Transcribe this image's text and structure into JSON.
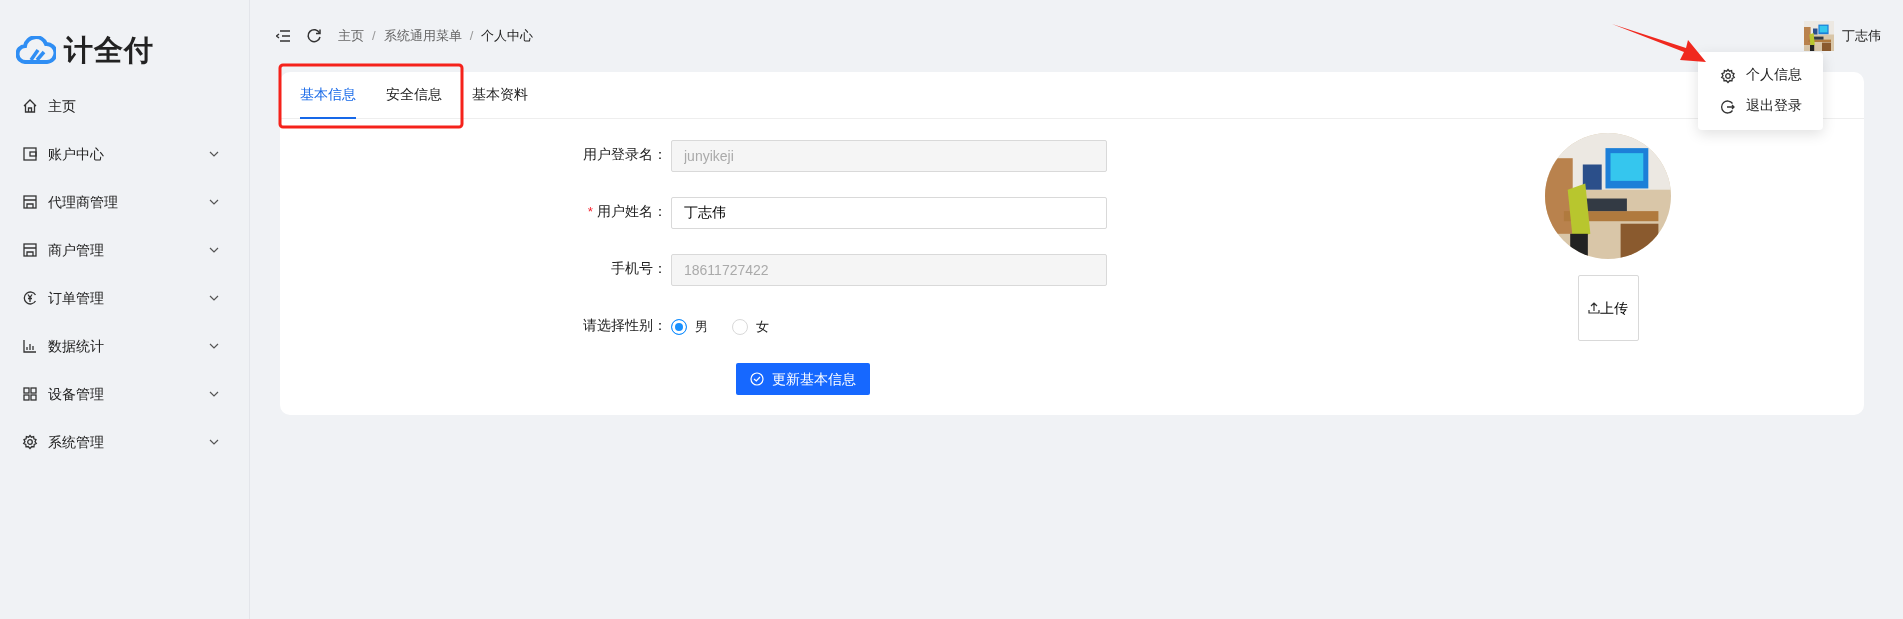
{
  "logo": {
    "text": "计全付"
  },
  "sidebar": {
    "items": [
      {
        "label": "主页",
        "kind": "home",
        "expandable": false
      },
      {
        "label": "账户中心",
        "kind": "wallet",
        "expandable": true
      },
      {
        "label": "代理商管理",
        "kind": "shop",
        "expandable": true
      },
      {
        "label": "商户管理",
        "kind": "shop",
        "expandable": true
      },
      {
        "label": "订单管理",
        "kind": "yuan",
        "expandable": true
      },
      {
        "label": "数据统计",
        "kind": "chart",
        "expandable": true
      },
      {
        "label": "设备管理",
        "kind": "grid",
        "expandable": true
      },
      {
        "label": "系统管理",
        "kind": "gear",
        "expandable": true
      }
    ]
  },
  "breadcrumb": [
    {
      "kind": "link",
      "text": "主页"
    },
    {
      "kind": "separator",
      "text": "/"
    },
    {
      "kind": "link",
      "text": "系统通用菜单"
    },
    {
      "kind": "separator",
      "text": "/"
    },
    {
      "kind": "current",
      "text": "个人中心"
    }
  ],
  "user": {
    "name": "丁志伟"
  },
  "user_menu": [
    {
      "label": "个人信息",
      "kind": "settings"
    },
    {
      "label": "退出登录",
      "kind": "logout"
    }
  ],
  "tabs": [
    {
      "label": "基本信息",
      "selected": true
    },
    {
      "label": "安全信息",
      "selected": false
    },
    {
      "label": "基本资料",
      "selected": false
    }
  ],
  "form": {
    "fields": [
      {
        "label": "用户登录名：",
        "value": "junyikeji",
        "disabled": true
      },
      {
        "label": "用户姓名：",
        "value": "丁志伟",
        "disabled": false,
        "required_mark": "*"
      },
      {
        "label": "手机号：",
        "value": "18611727422",
        "disabled": true
      }
    ],
    "gender": {
      "label": "请选择性别：",
      "options": [
        {
          "label": "男",
          "selected": true
        },
        {
          "label": "女",
          "selected": false
        }
      ]
    },
    "submit": "更新基本信息"
  },
  "upload": {
    "label": "上传"
  }
}
